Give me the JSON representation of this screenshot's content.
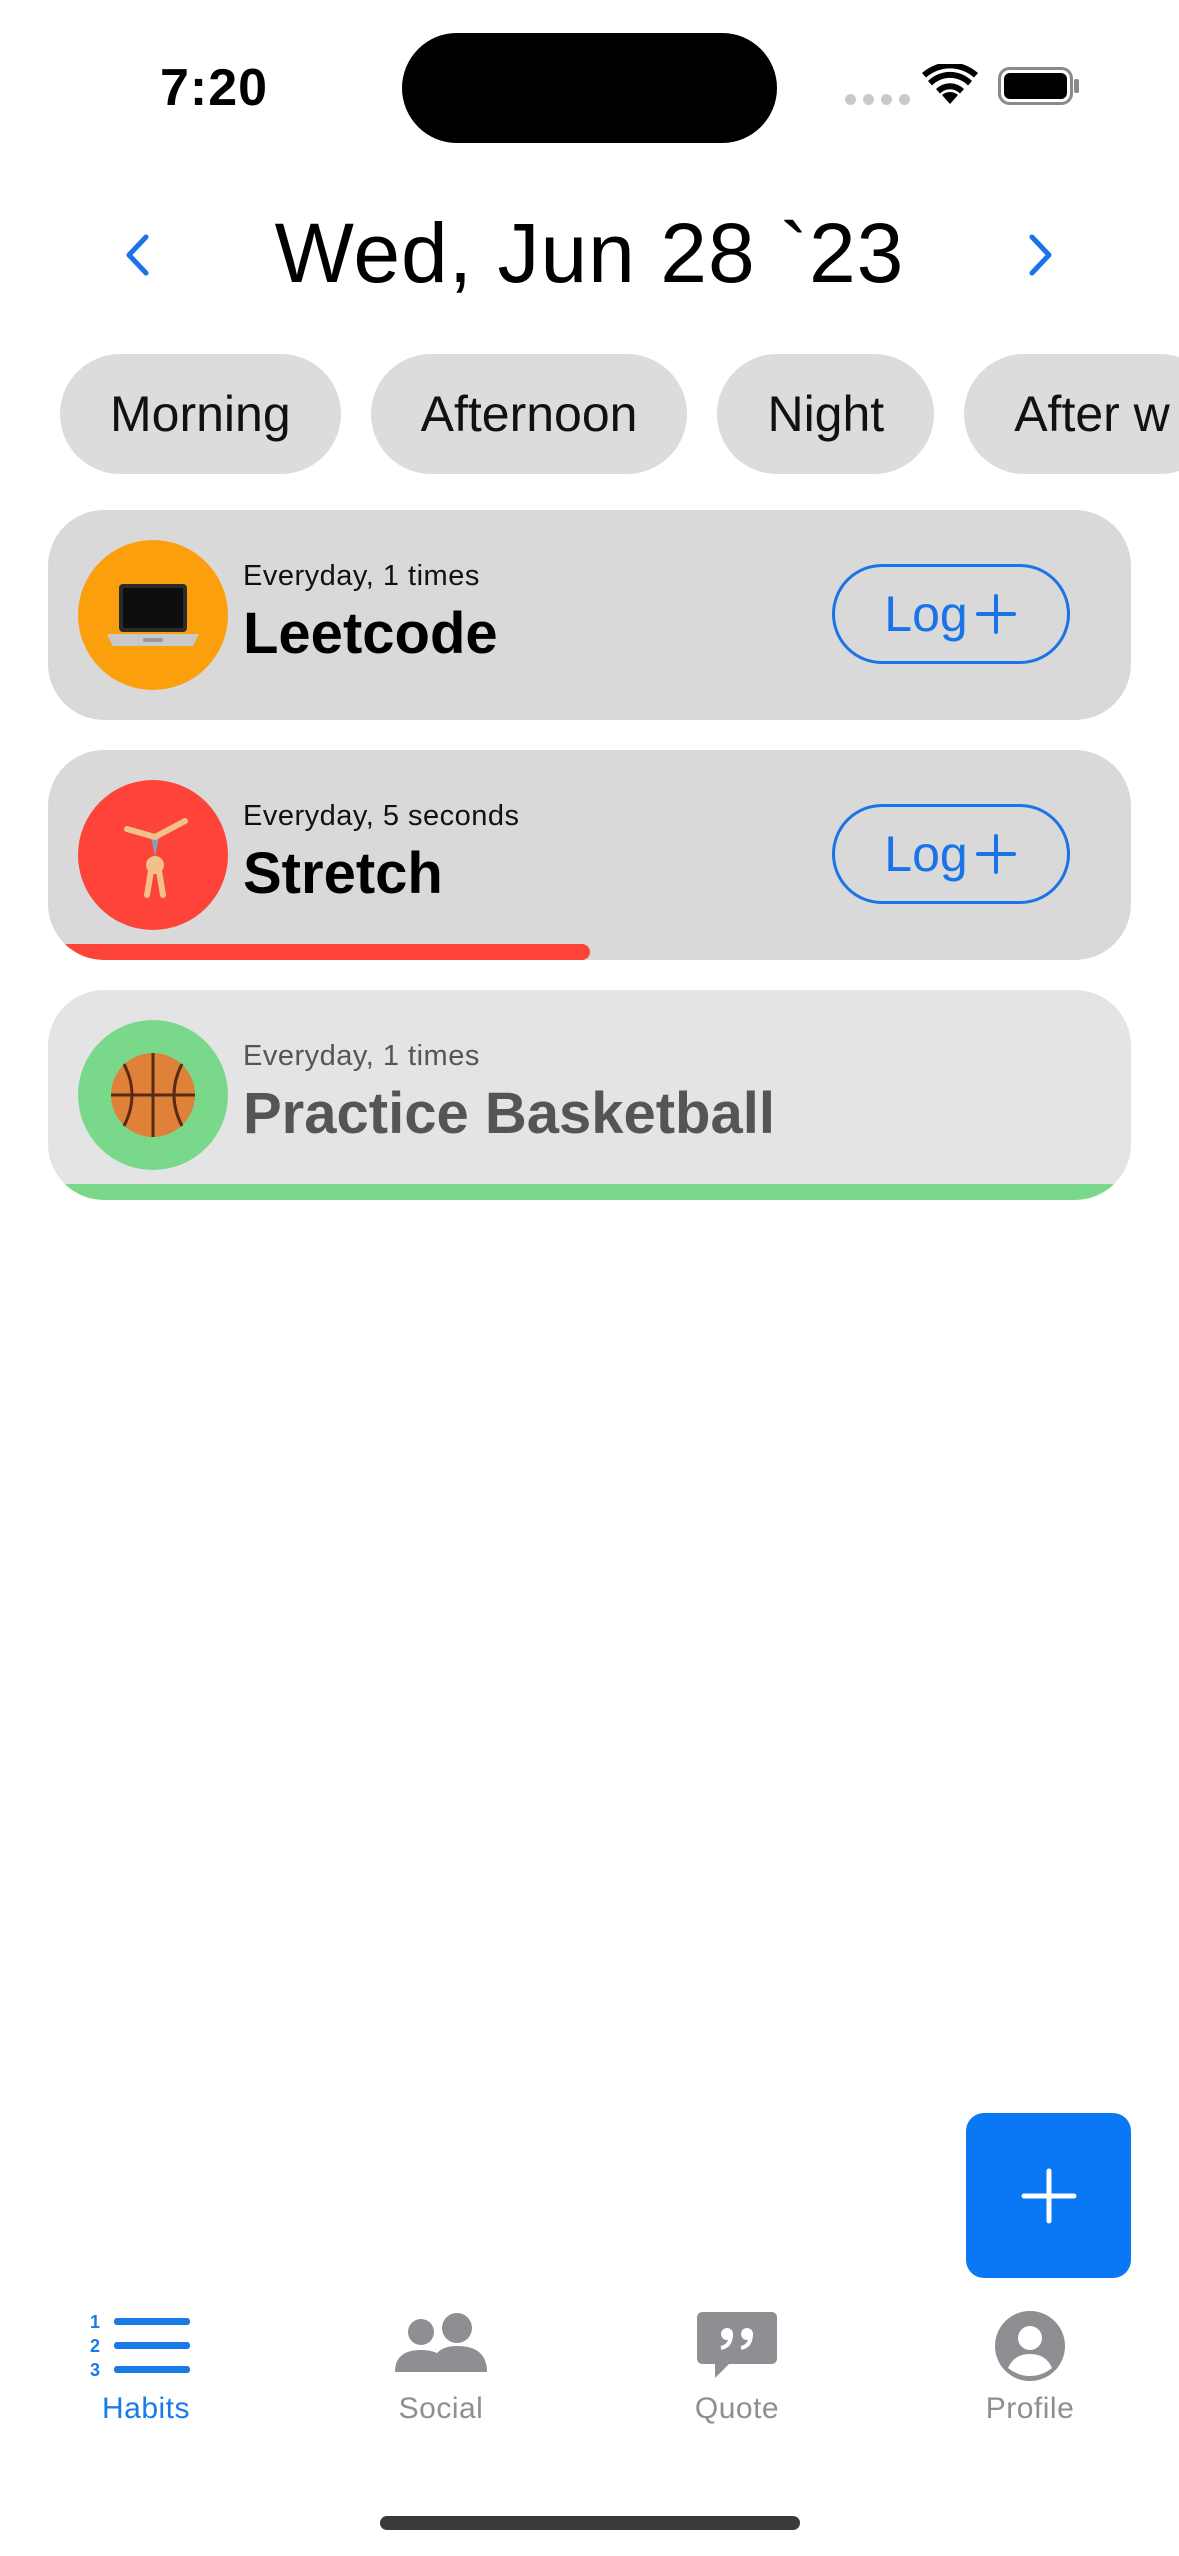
{
  "status_bar": {
    "time": "7:20"
  },
  "header": {
    "date_title": "Wed, Jun 28 `23",
    "prev_icon": "chevron-left-icon",
    "next_icon": "chevron-right-icon"
  },
  "filters": [
    "Morning",
    "Afternoon",
    "Night",
    "After w"
  ],
  "habits": [
    {
      "subtitle": "Everyday, 1 times",
      "name": "Leetcode",
      "icon": "laptop-icon",
      "emoji": "💻",
      "color": "#fba00c",
      "action_label": "Log",
      "progress": 0,
      "completed": false
    },
    {
      "subtitle": "Everyday, 5 seconds",
      "name": "Stretch",
      "icon": "cartwheel-icon",
      "emoji": "🤸",
      "color": "#fe4338",
      "action_label": "Log",
      "progress": 0.5,
      "progress_color": "#fe4338",
      "completed": false
    },
    {
      "subtitle": "Everyday, 1 times",
      "name": "Practice Basketball",
      "icon": "basketball-icon",
      "emoji": "🏀",
      "color": "#7ad88b",
      "progress": 1.0,
      "progress_color": "#7ad88b",
      "completed": true
    }
  ],
  "fab": {
    "icon": "plus-icon"
  },
  "tabs": [
    {
      "label": "Habits",
      "icon": "numbered-list-icon",
      "active": true
    },
    {
      "label": "Social",
      "icon": "people-icon",
      "active": false
    },
    {
      "label": "Quote",
      "icon": "quote-bubble-icon",
      "active": false
    },
    {
      "label": "Profile",
      "icon": "person-circle-icon",
      "active": false
    }
  ],
  "colors": {
    "accent": "#1a73e8",
    "fab": "#0a78f5",
    "card_bg": "#d9d9d9",
    "chip_bg": "#dcdcdc"
  }
}
